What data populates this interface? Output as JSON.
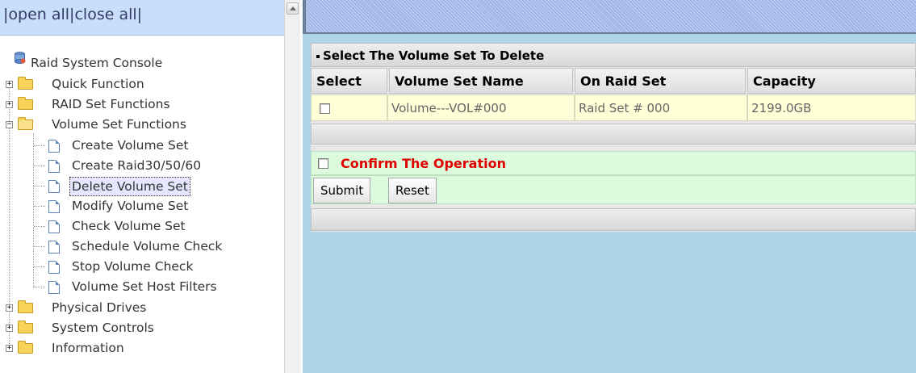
{
  "tree_header": {
    "open_all": "|open all|",
    "close_all": "close all|"
  },
  "tree": {
    "root": "Raid System Console",
    "quick_function": "Quick Function",
    "raid_set_functions": "RAID Set Functions",
    "volume_set_functions": "Volume Set Functions",
    "volume_items": [
      "Create Volume Set",
      "Create Raid30/50/60",
      "Delete Volume Set",
      "Modify Volume Set",
      "Check Volume Set",
      "Schedule Volume Check",
      "Stop Volume Check",
      "Volume Set Host Filters"
    ],
    "physical_drives": "Physical Drives",
    "system_controls": "System Controls",
    "information": "Information",
    "expand_symbol": "+",
    "collapse_symbol": "−"
  },
  "form": {
    "title": "Select The Volume Set To Delete",
    "columns": [
      "Select",
      "Volume Set Name",
      "On Raid Set",
      "Capacity"
    ],
    "rows": [
      {
        "name": "Volume---VOL#000",
        "raid_set": "Raid Set # 000",
        "capacity": "2199.0GB"
      }
    ],
    "confirm_label": "Confirm The Operation",
    "submit_label": "Submit",
    "reset_label": "Reset"
  },
  "colors": {
    "confirm_text": "#e00000",
    "row_background": "#ffffd8",
    "confirm_background": "#dcfadc",
    "right_background": "#aed6e8",
    "header_bar": "#c8defa"
  },
  "icons": [
    "raid-console-icon",
    "folder-icon",
    "page-icon",
    "expand-icon",
    "collapse-icon",
    "checkbox-icon",
    "scroll-up-icon"
  ]
}
